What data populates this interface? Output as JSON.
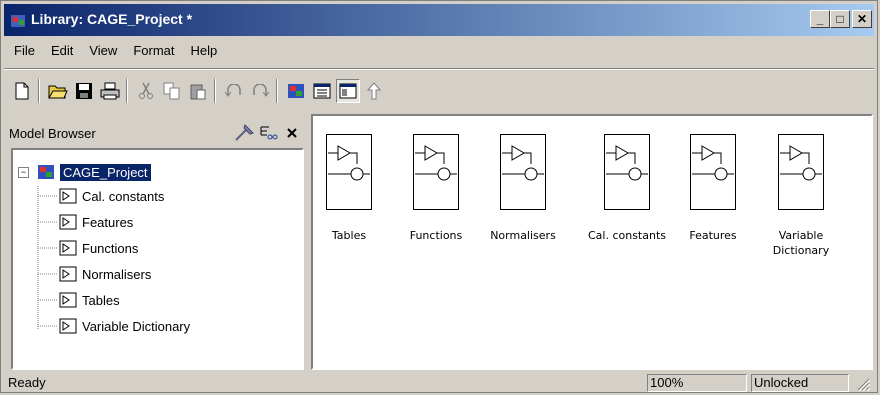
{
  "window": {
    "title": "Library: CAGE_Project *",
    "caption_buttons": {
      "minimize": "_",
      "maximize": "□",
      "close": "✕"
    }
  },
  "menu": [
    {
      "label": "File"
    },
    {
      "label": "Edit"
    },
    {
      "label": "View"
    },
    {
      "label": "Format"
    },
    {
      "label": "Help"
    }
  ],
  "toolbar": {
    "buttons": [
      {
        "icon": "new-file-icon"
      },
      {
        "icon": "open-folder-icon"
      },
      {
        "icon": "save-icon"
      },
      {
        "icon": "print-icon"
      },
      {
        "icon": "cut-icon"
      },
      {
        "icon": "copy-icon"
      },
      {
        "icon": "paste-icon"
      },
      {
        "icon": "undo-icon"
      },
      {
        "icon": "redo-icon"
      },
      {
        "icon": "library-browser-icon"
      },
      {
        "icon": "model-explorer-icon"
      },
      {
        "icon": "model-browser-toggle-icon"
      },
      {
        "icon": "go-to-parent-icon"
      }
    ]
  },
  "browser": {
    "label": "Model Browser",
    "tree": {
      "root": "CAGE_Project",
      "children": [
        "Cal. constants",
        "Features",
        "Functions",
        "Normalisers",
        "Tables",
        "Variable Dictionary"
      ]
    }
  },
  "blocks": [
    {
      "label": "Tables"
    },
    {
      "label": "Functions"
    },
    {
      "label": "Normalisers"
    },
    {
      "label": "Cal. constants"
    },
    {
      "label": "Features"
    },
    {
      "label": "Variable",
      "label2": "Dictionary"
    }
  ],
  "status": {
    "text": "Ready",
    "zoom": "100%",
    "lock": "Unlocked"
  },
  "colors": {
    "titlebar_start": "#0a246a",
    "titlebar_end": "#a6caf0",
    "selection": "#0a246a",
    "face": "#d4d0c8"
  }
}
